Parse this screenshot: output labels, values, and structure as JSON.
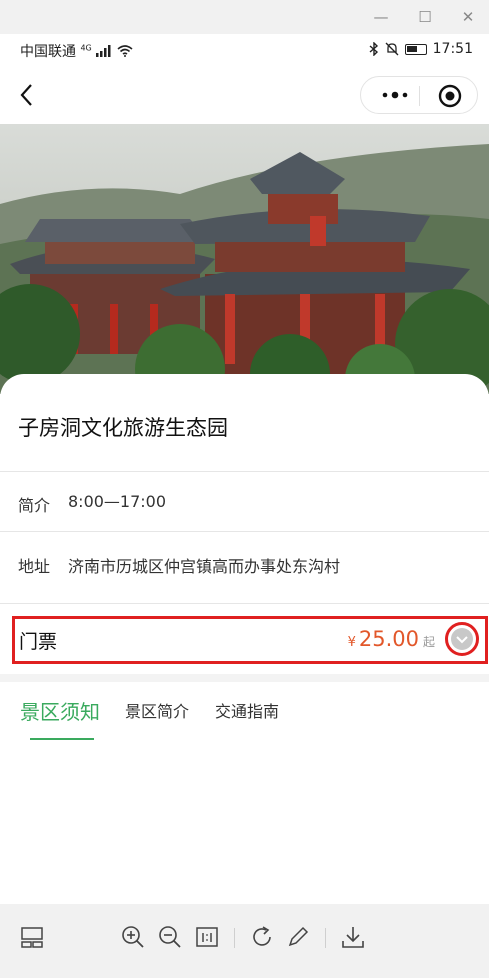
{
  "window": {
    "minimize": "—",
    "maximize": "☐",
    "close": "✕"
  },
  "status_bar": {
    "carrier": "中国联通",
    "network": "4G",
    "time": "17:51",
    "battery_level": 0.6
  },
  "nav": {
    "back_icon": "chevron-left-icon",
    "more_icon": "more-dots-icon",
    "target_icon": "target-icon"
  },
  "place": {
    "name": "子房洞文化旅游生态园",
    "intro_label": "简介",
    "hours": "8:00—17:00",
    "address_label": "地址",
    "address": "济南市历城区仲宫镇高而办事处东沟村"
  },
  "ticket": {
    "label": "门票",
    "currency": "¥",
    "price": "25.00",
    "suffix": "起"
  },
  "tabs": [
    {
      "label": "景区须知",
      "active": true
    },
    {
      "label": "景区简介",
      "active": false
    },
    {
      "label": "交通指南",
      "active": false
    }
  ],
  "colors": {
    "accent_green": "#3aaa5e",
    "price_orange": "#e2572a",
    "highlight_red": "#e02020"
  }
}
